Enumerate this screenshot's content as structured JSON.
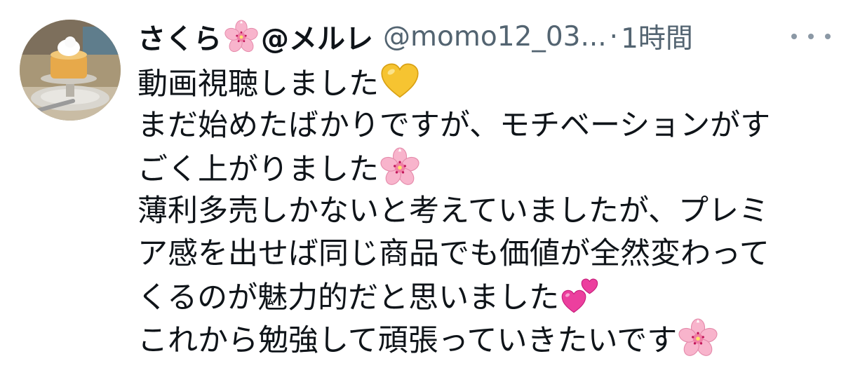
{
  "tweet": {
    "author": {
      "display_name": "さくら",
      "display_name_suffix": "@メルレ",
      "name_emoji": "cherry-blossom",
      "handle": "@momo12_03...",
      "avatar": "pudding-dessert-photo"
    },
    "separator": "·",
    "time": "1時間",
    "more_icon": "more-horizontal-icon",
    "lines": [
      {
        "text": "動画視聴しました",
        "emoji": "yellow-heart"
      },
      {
        "text": "まだ始めたばかりですが、モチベーションがす",
        "emoji": ""
      },
      {
        "text": "ごく上がりました",
        "emoji": "cherry-blossom"
      },
      {
        "text": "薄利多売しかないと考えていましたが、プレミ",
        "emoji": ""
      },
      {
        "text": "ア感を出せば同じ商品でも価値が全然変わって",
        "emoji": ""
      },
      {
        "text": "くるのが魅力的だと思いました",
        "emoji": "two-hearts"
      },
      {
        "text": "これから勉強して頑張っていきたいです",
        "emoji": "cherry-blossom"
      }
    ]
  },
  "colors": {
    "text_primary": "#0f1419",
    "text_secondary": "#536471",
    "cherry_blossom": "#f7a8c4",
    "yellow_heart": "#f6c431",
    "pink_heart": "#e8339b"
  }
}
